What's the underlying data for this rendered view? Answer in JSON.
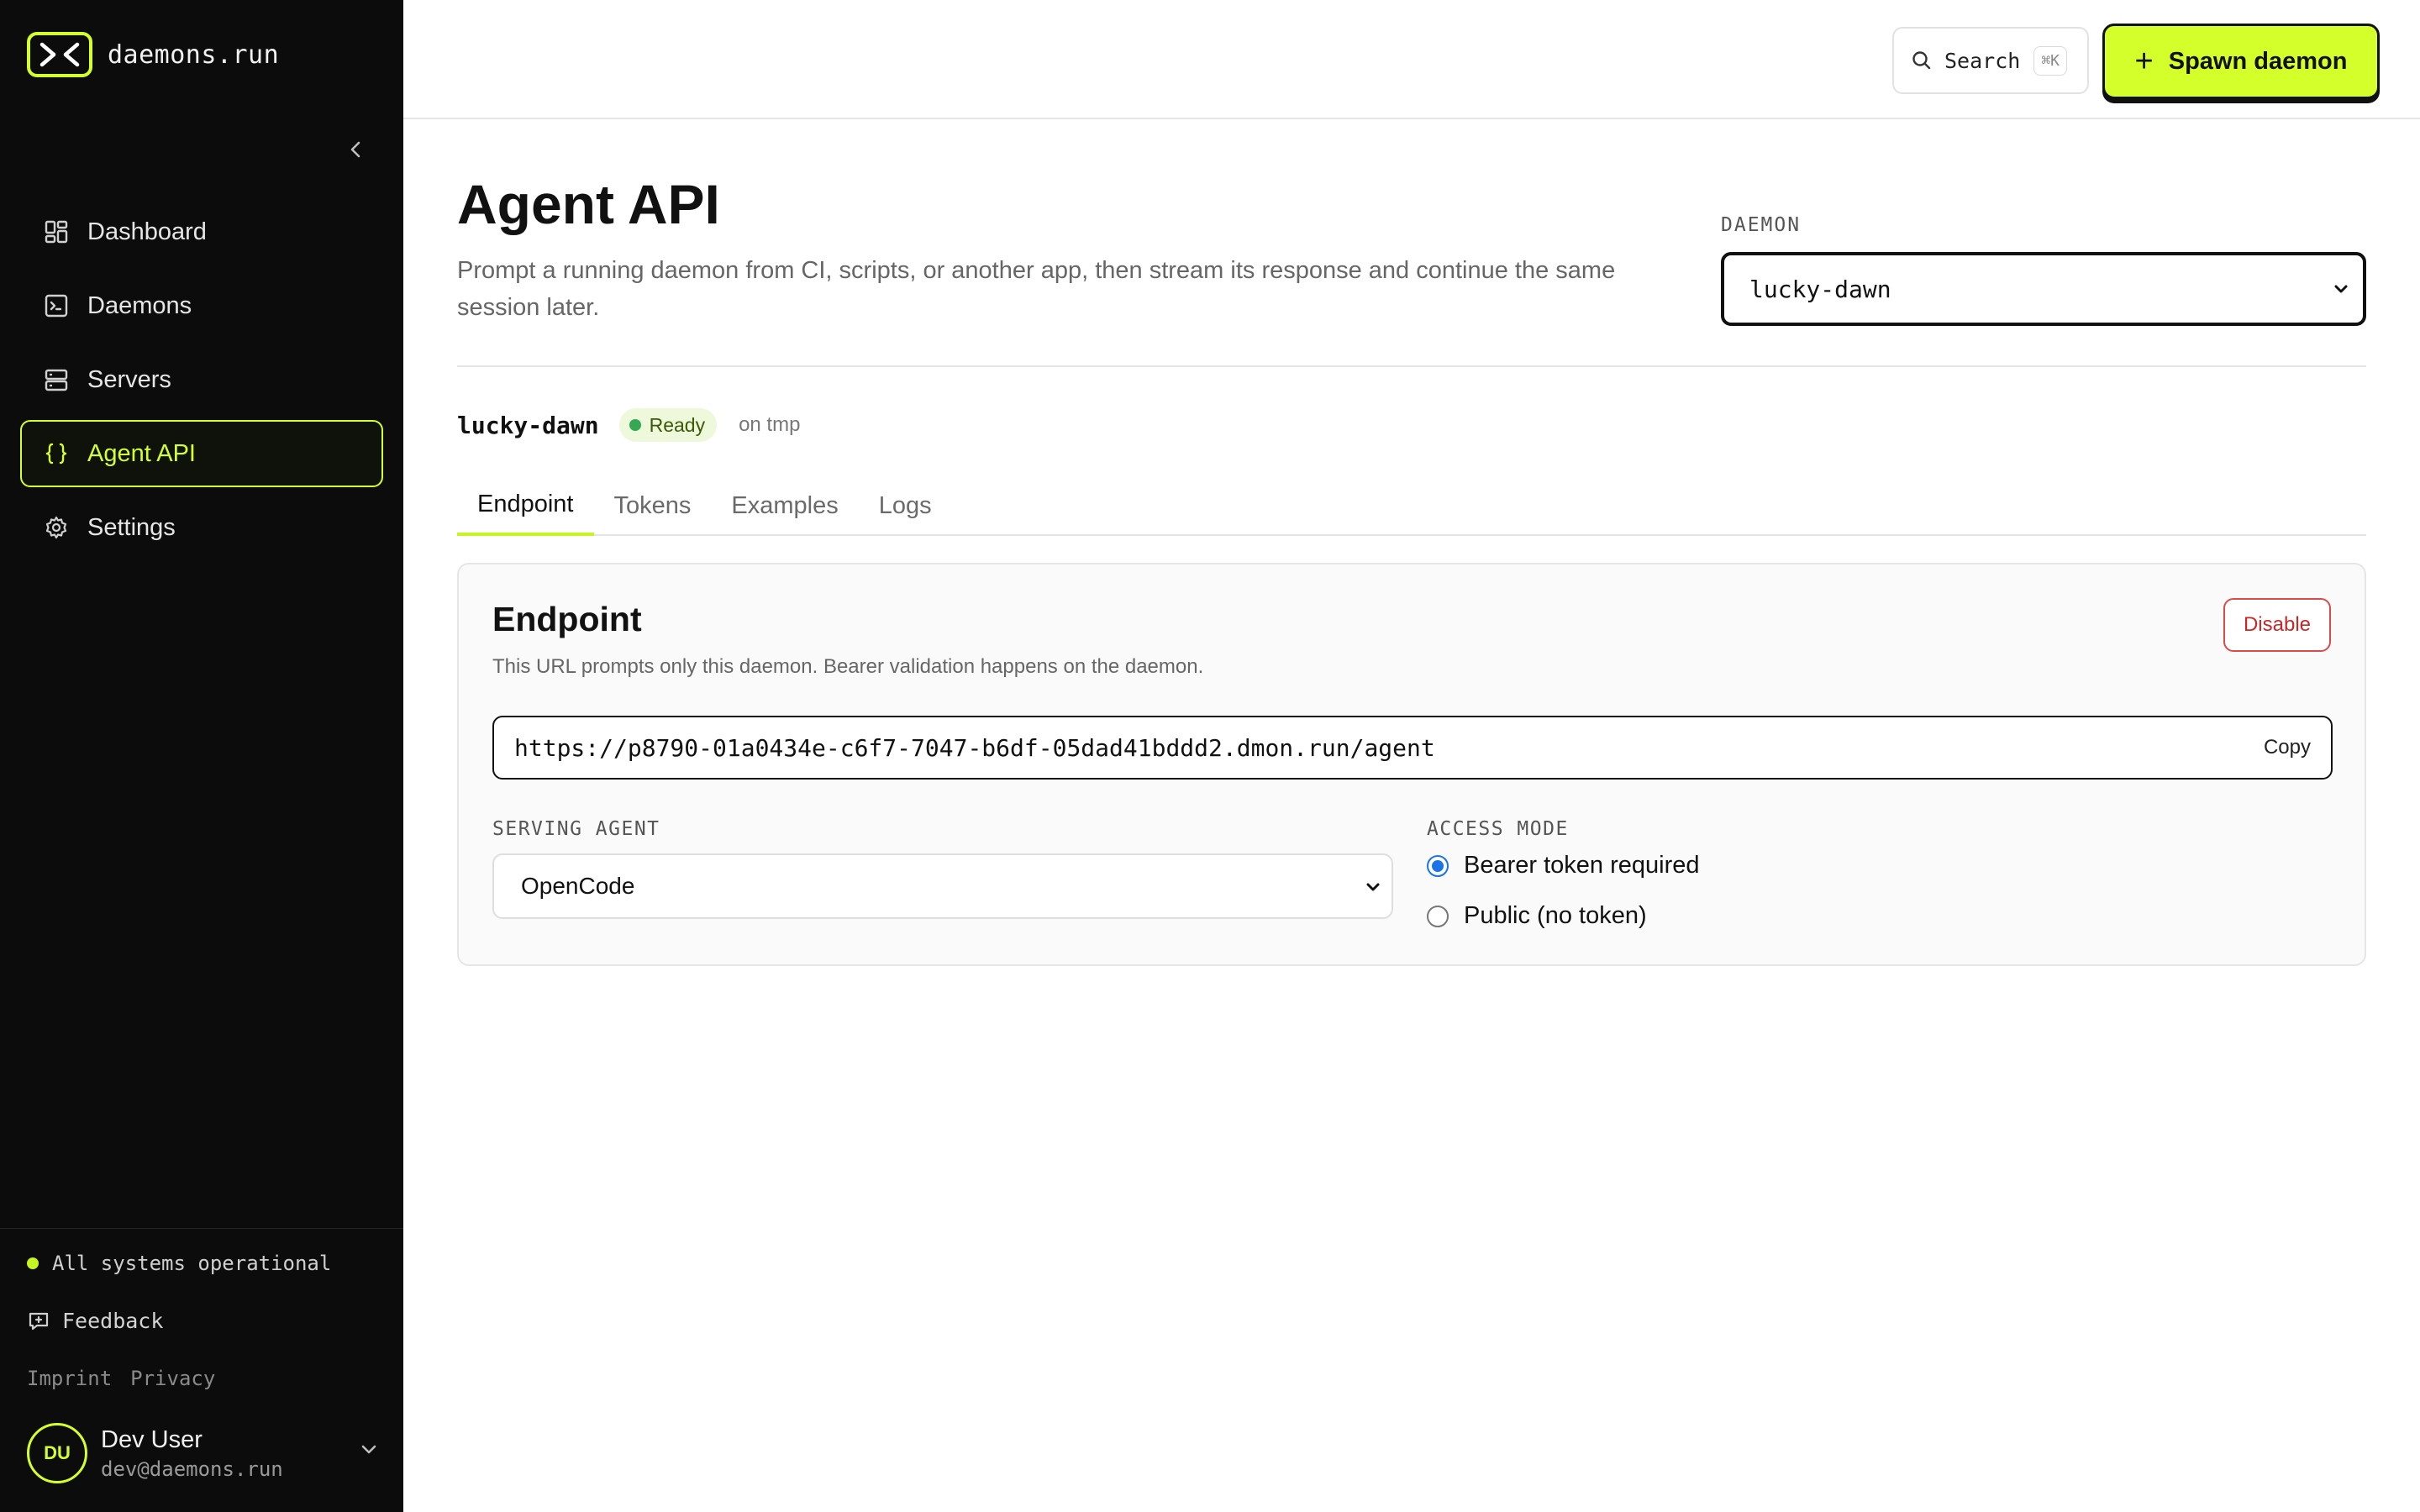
{
  "brand": {
    "name": "daemons.run",
    "logo_icon": "terminal-brackets-icon",
    "accent": "#d4ff2a"
  },
  "sidebar": {
    "items": [
      {
        "label": "Dashboard",
        "icon": "grid-icon",
        "active": false
      },
      {
        "label": "Daemons",
        "icon": "terminal-window-icon",
        "active": false
      },
      {
        "label": "Servers",
        "icon": "server-icon",
        "active": false
      },
      {
        "label": "Agent API",
        "icon": "braces-icon",
        "active": true
      },
      {
        "label": "Settings",
        "icon": "gear-icon",
        "active": false
      }
    ],
    "status": "All systems operational",
    "feedback": "Feedback",
    "links": [
      "Imprint",
      "Privacy"
    ],
    "user": {
      "initials": "DU",
      "name": "Dev User",
      "email": "dev@daemons.run"
    }
  },
  "topbar": {
    "search_label": "Search",
    "search_shortcut": "⌘K",
    "spawn_label": "Spawn daemon"
  },
  "page": {
    "title": "Agent API",
    "description": "Prompt a running daemon from CI, scripts, or another app, then stream its response and continue the same session later.",
    "daemon_label": "DAEMON",
    "daemon_selected": "lucky-dawn"
  },
  "daemon": {
    "name": "lucky-dawn",
    "status": "Ready",
    "host": "on tmp",
    "status_color": "#34a853"
  },
  "tabs": [
    {
      "label": "Endpoint",
      "active": true
    },
    {
      "label": "Tokens",
      "active": false
    },
    {
      "label": "Examples",
      "active": false
    },
    {
      "label": "Logs",
      "active": false
    }
  ],
  "endpoint": {
    "title": "Endpoint",
    "description": "This URL prompts only this daemon. Bearer validation happens on the daemon.",
    "disable_label": "Disable",
    "url": "https://p8790-01a0434e-c6f7-7047-b6df-05dad41bddd2.dmon.run/agent",
    "copy_label": "Copy",
    "serving_agent_label": "SERVING AGENT",
    "serving_agent_value": "OpenCode",
    "access_mode_label": "ACCESS MODE",
    "access_options": [
      {
        "label": "Bearer token required",
        "checked": true
      },
      {
        "label": "Public (no token)",
        "checked": false
      }
    ]
  }
}
